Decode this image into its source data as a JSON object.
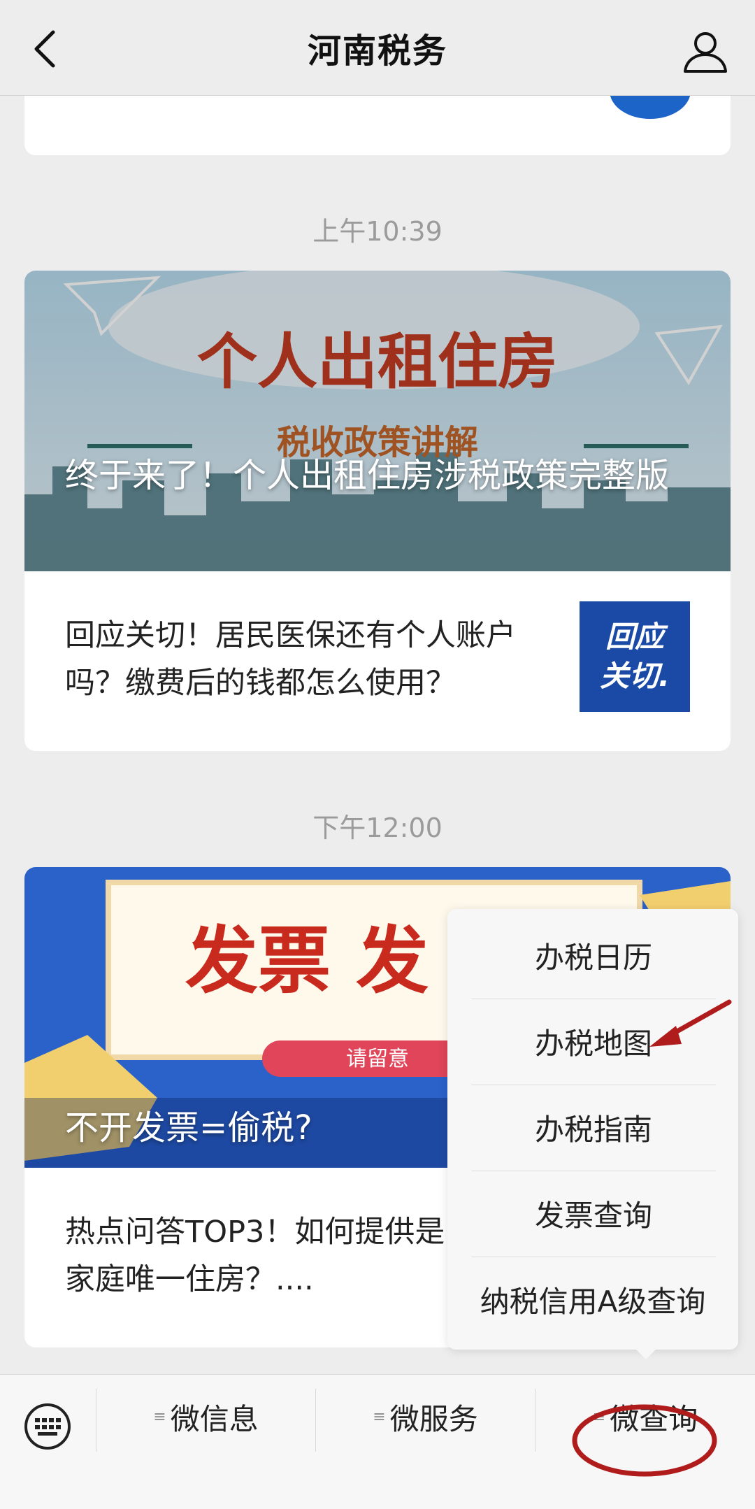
{
  "header": {
    "title": "河南税务"
  },
  "feed": [
    {
      "time": "上午10:39",
      "cover_headline": "个人出租住房",
      "cover_subheadline": "税收政策讲解",
      "cover_title": "终于来了！个人出租住房涉税政策完整版",
      "row_text": "回应关切！居民医保还有个人账户吗？缴费后的钱都怎么使用？",
      "thumb_text": [
        "回应",
        "关切."
      ]
    },
    {
      "time": "下午12:00",
      "cover_headline": "发票  发",
      "cover_badge": "请留意",
      "cover_title": "不开发票=偷税?",
      "row_text": "热点问答TOP3！如何提供是家庭唯一住房？...."
    }
  ],
  "popup_menu": {
    "items": [
      "办税日历",
      "办税地图",
      "办税指南",
      "发票查询",
      "纳税信用A级查询"
    ]
  },
  "bottom_bar": {
    "tabs": [
      "微信息",
      "微服务",
      "微查询"
    ]
  },
  "colors": {
    "annotation_red": "#b01b1b",
    "accent_blue": "#1b4aa6"
  }
}
